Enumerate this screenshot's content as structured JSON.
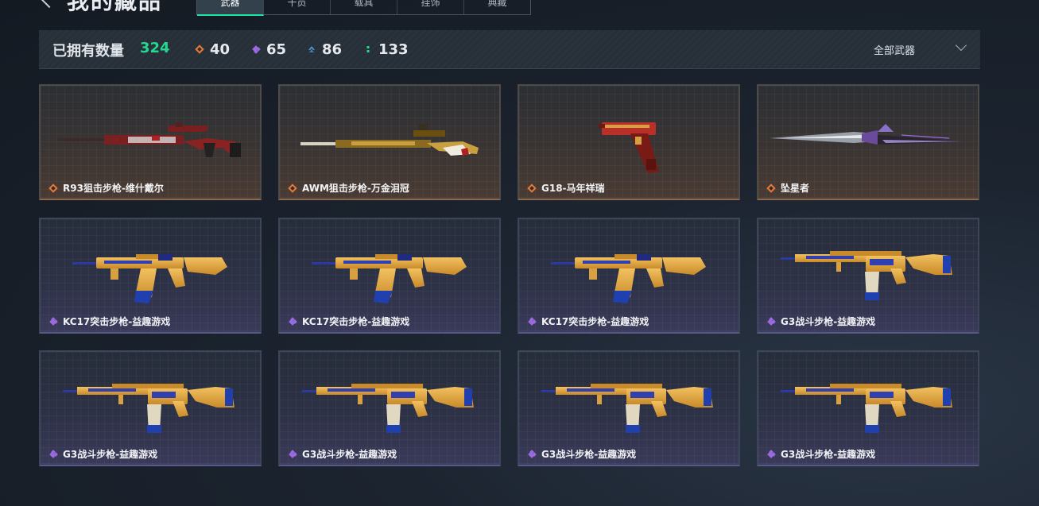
{
  "header": {
    "title": "我的藏品",
    "tabs": [
      "武器",
      "干员",
      "载具",
      "挂饰",
      "典藏"
    ]
  },
  "stats": {
    "owned_label": "已拥有数量",
    "owned_count": "324",
    "tiers": [
      {
        "icon": "orange-diamond-icon",
        "value": "40",
        "color": "#e07a3c"
      },
      {
        "icon": "purple-diamond-icon",
        "value": "65",
        "color": "#9b6ae0"
      },
      {
        "icon": "blue-chevron-icon",
        "value": "86",
        "color": "#4a9ee0"
      },
      {
        "icon": "green-dots-icon",
        "value": "133",
        "color": "#22d98f"
      }
    ],
    "filter_label": "全部武器"
  },
  "items": [
    {
      "name": "R93狙击步枪-维什戴尔",
      "rarity": "orange",
      "weapon": "sniper-red"
    },
    {
      "name": "AWM狙击步枪-万金泪冠",
      "rarity": "orange",
      "weapon": "sniper-gold"
    },
    {
      "name": "G18-马年祥瑞",
      "rarity": "orange",
      "weapon": "pistol-red"
    },
    {
      "name": "坠星者",
      "rarity": "orange",
      "weapon": "knife-purple"
    },
    {
      "name": "KC17突击步枪-益趣游戏",
      "rarity": "purple",
      "weapon": "rifle-kc17"
    },
    {
      "name": "KC17突击步枪-益趣游戏",
      "rarity": "purple",
      "weapon": "rifle-kc17"
    },
    {
      "name": "KC17突击步枪-益趣游戏",
      "rarity": "purple",
      "weapon": "rifle-kc17"
    },
    {
      "name": "G3战斗步枪-益趣游戏",
      "rarity": "purple",
      "weapon": "rifle-g3"
    },
    {
      "name": "G3战斗步枪-益趣游戏",
      "rarity": "purple",
      "weapon": "rifle-g3"
    },
    {
      "name": "G3战斗步枪-益趣游戏",
      "rarity": "purple",
      "weapon": "rifle-g3"
    },
    {
      "name": "G3战斗步枪-益趣游戏",
      "rarity": "purple",
      "weapon": "rifle-g3"
    },
    {
      "name": "G3战斗步枪-益趣游戏",
      "rarity": "purple",
      "weapon": "rifle-g3"
    }
  ]
}
